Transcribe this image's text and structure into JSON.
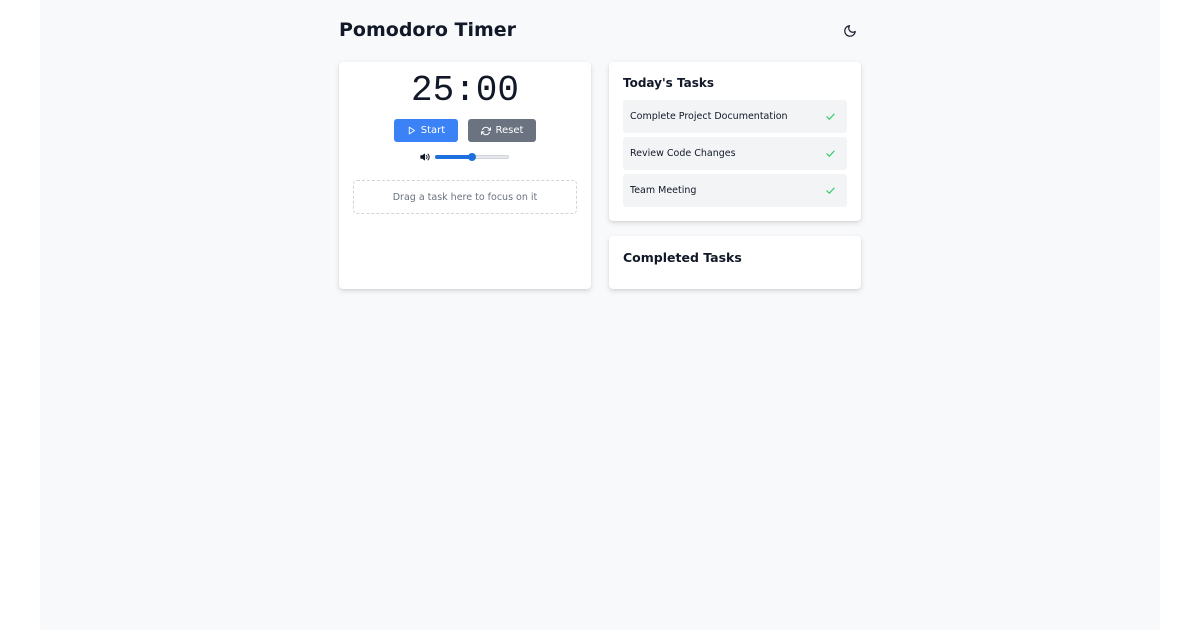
{
  "header": {
    "title": "Pomodoro Timer",
    "theme_icon": "moon-icon"
  },
  "timer": {
    "display": "25:00",
    "start_label": "Start",
    "start_icon": "play-icon",
    "reset_label": "Reset",
    "reset_icon": "refresh-icon",
    "volume_icon": "volume-icon",
    "volume_level": 0.5,
    "drop_zone_text": "Drag a task here to focus on it"
  },
  "tasks": {
    "title": "Today's Tasks",
    "items": [
      {
        "label": "Complete Project Documentation",
        "icon": "check-icon"
      },
      {
        "label": "Review Code Changes",
        "icon": "check-icon"
      },
      {
        "label": "Team Meeting",
        "icon": "check-icon"
      }
    ]
  },
  "completed": {
    "title": "Completed Tasks"
  },
  "colors": {
    "accent": "#3b82f6",
    "secondary_button": "#6b7280",
    "check": "#22c55e",
    "page_background": "#f8f9fb"
  }
}
